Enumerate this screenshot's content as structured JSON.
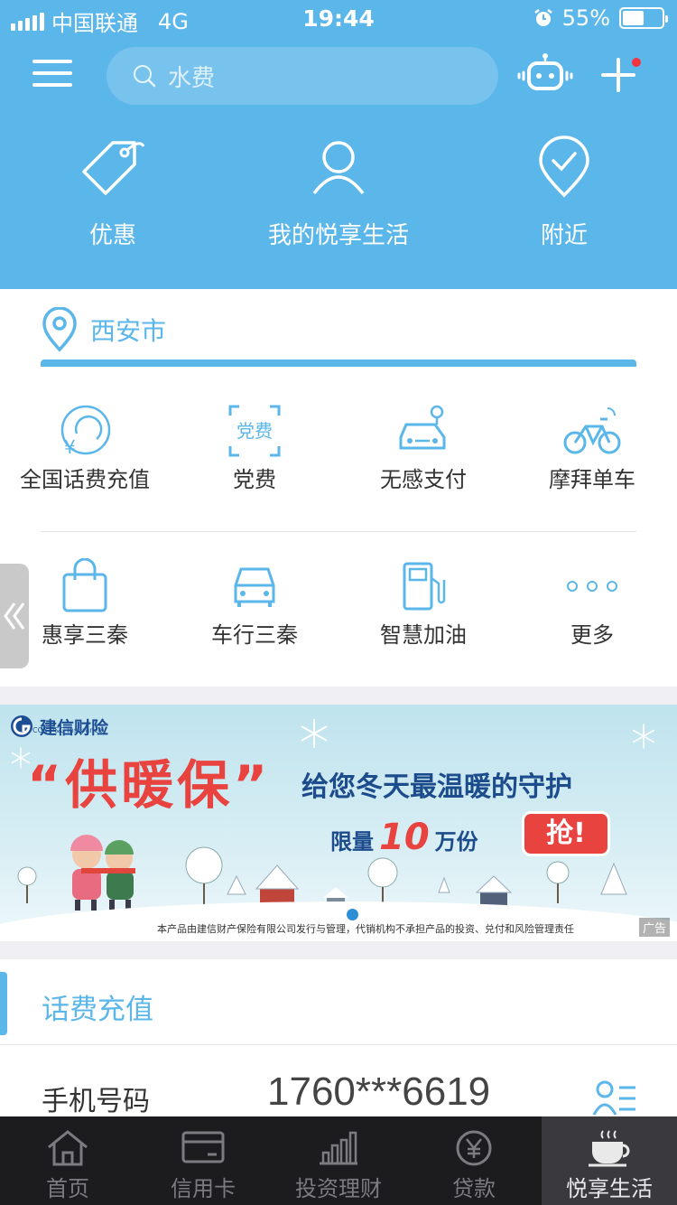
{
  "status_bar": {
    "carrier": "中国联通",
    "network": "4G",
    "time": "19:44",
    "battery": "55%",
    "battery_level": 0.55
  },
  "search": {
    "placeholder": "水费"
  },
  "top_nav": [
    {
      "label": "优惠",
      "icon": "tag-icon"
    },
    {
      "label": "我的悦享生活",
      "icon": "user-icon"
    },
    {
      "label": "附近",
      "icon": "location-check-icon"
    }
  ],
  "city": {
    "name": "西安市"
  },
  "services": [
    {
      "label": "全国话费充值",
      "icon": "phone-recharge-icon"
    },
    {
      "label": "党费",
      "icon": "party-fee-icon",
      "icon_text": "党费"
    },
    {
      "label": "无感支付",
      "icon": "car-pay-icon"
    },
    {
      "label": "摩拜单车",
      "icon": "bicycle-icon"
    },
    {
      "label": "惠享三秦",
      "icon": "shopping-bag-icon"
    },
    {
      "label": "车行三秦",
      "icon": "car-icon"
    },
    {
      "label": "智慧加油",
      "icon": "fuel-icon"
    },
    {
      "label": "更多",
      "icon": "more-icon"
    }
  ],
  "banner": {
    "brand_name": "建信财险",
    "brand_sub": "CCB P&C Insurance",
    "title": "“供暖保”",
    "subtitle": "给您冬天最温暖的守护",
    "limit_prefix": "限量",
    "limit_number": "10",
    "limit_suffix": "万份",
    "cta": "抢!",
    "disclaimer": "本产品由建信财产保险有限公司发行与管理，代销机构不承担产品的投资、兑付和风险管理责任",
    "ad_tag": "广告"
  },
  "recharge": {
    "title": "话费充值",
    "phone_label": "手机号码",
    "phone_value": "1760***6619"
  },
  "tab_bar": [
    {
      "label": "首页",
      "icon": "home-icon",
      "active": false
    },
    {
      "label": "信用卡",
      "icon": "credit-card-icon",
      "active": false
    },
    {
      "label": "投资理财",
      "icon": "bar-chart-icon",
      "active": false
    },
    {
      "label": "贷款",
      "icon": "yuan-coin-icon",
      "active": false
    },
    {
      "label": "悦享生活",
      "icon": "coffee-cup-icon",
      "active": true
    }
  ],
  "colors": {
    "brand_blue": "#5bb6ea",
    "tabbar_bg": "#1c1c1f",
    "accent_red": "#e8433f"
  }
}
